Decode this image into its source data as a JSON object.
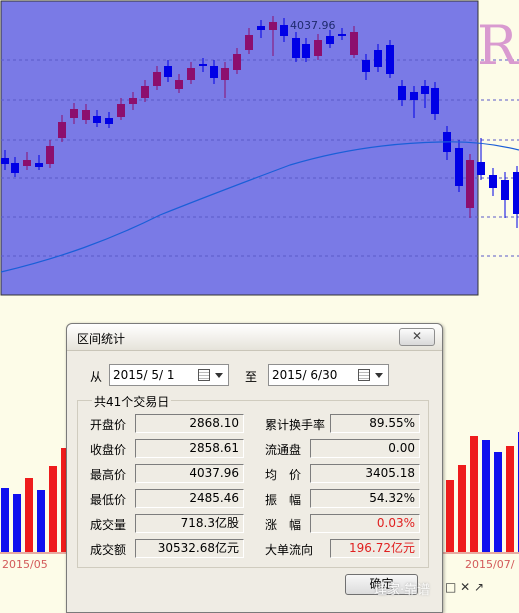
{
  "chart": {
    "peak_label": "4037.96",
    "side_letter": "R",
    "date_left": "2015/05",
    "date_right": "2015/07/",
    "colors": {
      "panel": "#7a7ae6",
      "up": "#8c0f6e",
      "down": "#0000e6",
      "ma": "#1a5fd8",
      "volume_up": "#ee1c1c",
      "volume_down": "#1010ee",
      "grid": "#5a5ac8"
    }
  },
  "dialog": {
    "title": "区间统计",
    "close_label": "✕",
    "from_label": "从",
    "from_date": "2015/ 5/ 1",
    "to_label": "至",
    "to_date": "2015/ 6/30",
    "group_title": "共41个交易日",
    "left_stats": [
      {
        "label": "开盘价",
        "value": "2868.10"
      },
      {
        "label": "收盘价",
        "value": "2858.61"
      },
      {
        "label": "最高价",
        "value": "4037.96"
      },
      {
        "label": "最低价",
        "value": "2485.46"
      },
      {
        "label": "成交量",
        "value": "718.3亿股"
      },
      {
        "label": "成交额",
        "value": "30532.68亿元"
      }
    ],
    "right_stats": [
      {
        "label": "累计换手率",
        "value": "89.55%"
      },
      {
        "label": "流通盘",
        "value": "0.00"
      },
      {
        "label": "均　价",
        "value": "3405.18"
      },
      {
        "label": "振　幅",
        "value": "54.32%"
      },
      {
        "label": "涨　幅",
        "value": "0.03%"
      },
      {
        "label": "大单流向",
        "value": "196.72亿元"
      }
    ],
    "ok_label": "确定"
  },
  "watermark": "理家·靠谱",
  "taskbar_icons": "□ ✕ ↗"
}
